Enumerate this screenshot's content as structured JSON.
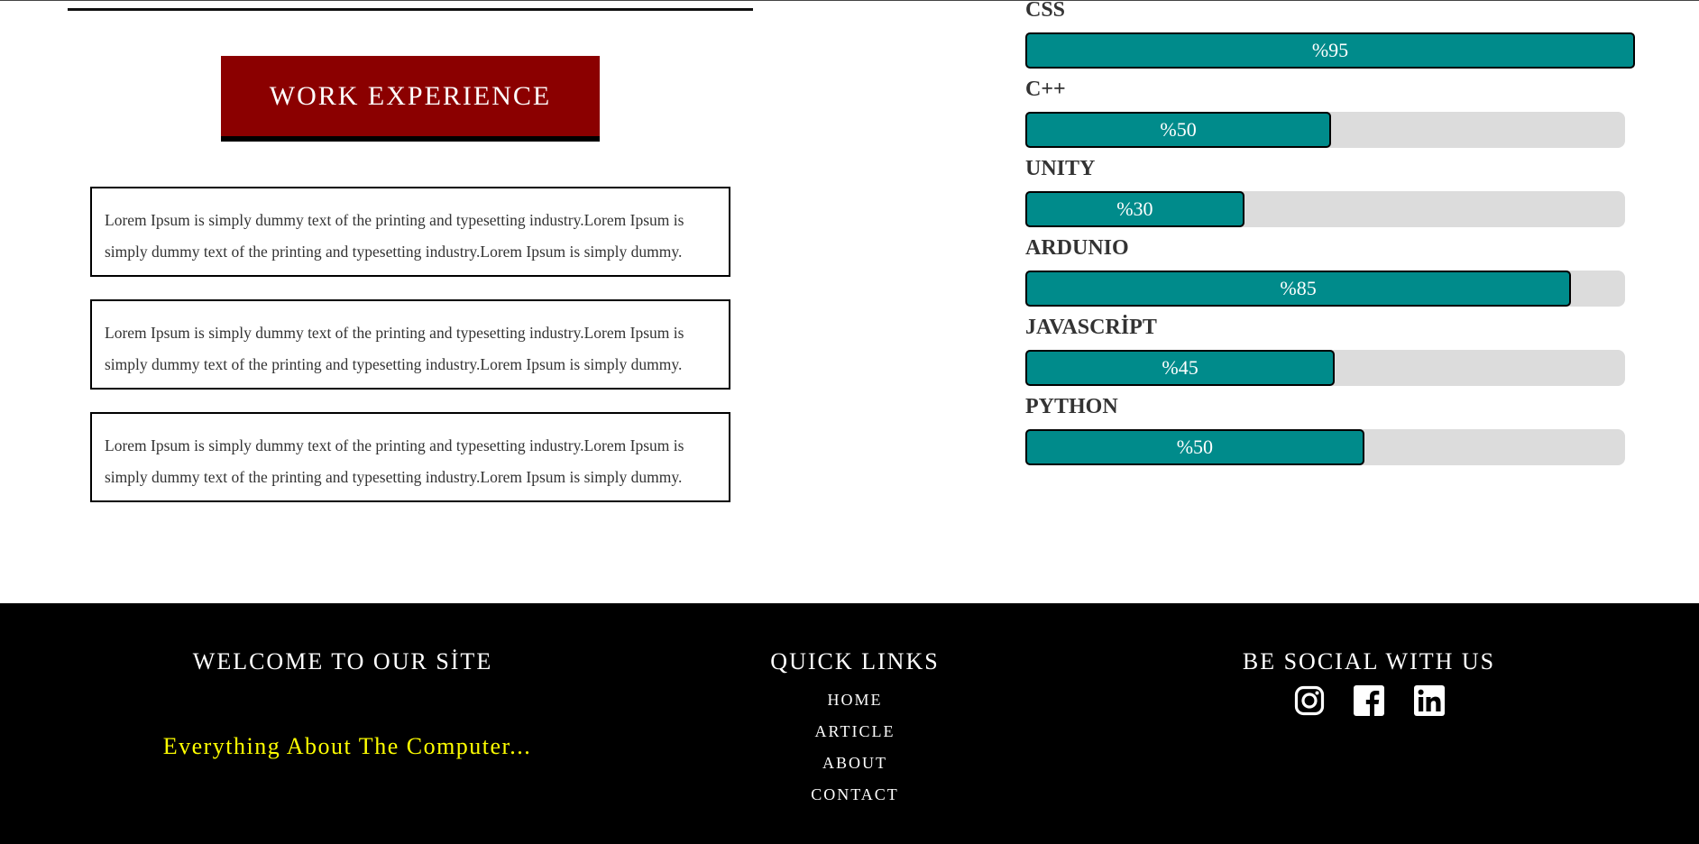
{
  "work_experience": {
    "title": "WORK EXPERIENCE",
    "entries": [
      "Lorem Ipsum is simply dummy text of the printing and typesetting industry.Lorem Ipsum is simply dummy text of the printing and typesetting industry.Lorem Ipsum is simply dummy.",
      "Lorem Ipsum is simply dummy text of the printing and typesetting industry.Lorem Ipsum is simply dummy text of the printing and typesetting industry.Lorem Ipsum is simply dummy.",
      "Lorem Ipsum is simply dummy text of the printing and typesetting industry.Lorem Ipsum is simply dummy text of the printing and typesetting industry.Lorem Ipsum is simply dummy."
    ]
  },
  "skills": [
    {
      "name": "CSS",
      "label": "%95",
      "percent": 100
    },
    {
      "name": "C++",
      "label": "%50",
      "percent": 51
    },
    {
      "name": "UNITY",
      "label": "%30",
      "percent": 36.5
    },
    {
      "name": "ARDUNIO",
      "label": "%85",
      "percent": 91
    },
    {
      "name": "JAVASCRİPT",
      "label": "%45",
      "percent": 51.6
    },
    {
      "name": "PYTHON",
      "label": "%50",
      "percent": 56.5
    }
  ],
  "colors": {
    "accent_red": "#8b0000",
    "bar_fill": "#008b8b",
    "bar_track": "#dcdcdc",
    "footer_bg": "#000000",
    "tagline": "#ffff00"
  },
  "footer": {
    "welcome_heading": "WELCOME TO OUR SİTE",
    "tagline": "Everything About The Computer...",
    "quick_links_heading": "QUICK LINKS",
    "quick_links": [
      "HOME",
      "ARTICLE",
      "ABOUT",
      "CONTACT"
    ],
    "social_heading": "BE SOCIAL WITH US",
    "social_icons": [
      "instagram-icon",
      "facebook-icon",
      "linkedin-icon"
    ]
  }
}
